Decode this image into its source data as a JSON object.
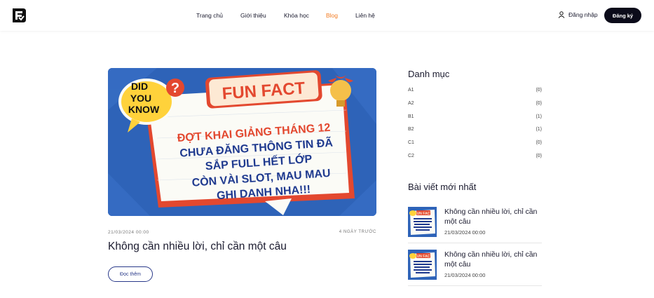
{
  "header": {
    "logo_icon": "lf-logo-icon",
    "nav": [
      {
        "label": "Trang chủ",
        "active": false
      },
      {
        "label": "Giới thiệu",
        "active": false
      },
      {
        "label": "Khóa học",
        "active": false
      },
      {
        "label": "Blog",
        "active": true
      },
      {
        "label": "Liên hệ",
        "active": false
      }
    ],
    "login_label": "Đăng nhập",
    "login_icon": "user-icon",
    "signup_label": "Đăng ký",
    "accent_color": "#f27b22"
  },
  "post": {
    "image": {
      "badge_line1": "DID",
      "badge_line2": "YOU",
      "badge_line3": "KNOW",
      "badge_mark": "?",
      "tag": "FUN FACT",
      "headline": [
        "ĐỢT KHAI GIẢNG THÁNG 12",
        "CHƯA ĐĂNG THÔNG TIN ĐÃ",
        "SẮP FULL HẾT LỚP",
        "CÒN VÀI SLOT, MAU MAU",
        "GHI DANH NHA!!!"
      ]
    },
    "date": "21/03/2024 00:00",
    "relative_time": "4 NGÀY TRƯỚC",
    "title": "Không cần nhiều lời, chỉ cần một câu",
    "read_more": "Đọc thêm"
  },
  "sidebar": {
    "categories_title": "Danh mục",
    "categories": [
      {
        "name": "A1",
        "count": "(0)"
      },
      {
        "name": "A2",
        "count": "(0)"
      },
      {
        "name": "B1",
        "count": "(1)"
      },
      {
        "name": "B2",
        "count": "(1)"
      },
      {
        "name": "C1",
        "count": "(0)"
      },
      {
        "name": "C2",
        "count": "(0)"
      }
    ],
    "recent_title": "Bài viết mới nhất",
    "recent": [
      {
        "title": "Không cần nhiều lời, chỉ cần một câu",
        "date": "21/03/2024 00:00",
        "thumb_tag": "FUN FACT"
      },
      {
        "title": "Không cần nhiều lời, chỉ cần một câu",
        "date": "21/03/2024 00:00",
        "thumb_tag": "FUN FACT"
      }
    ]
  }
}
